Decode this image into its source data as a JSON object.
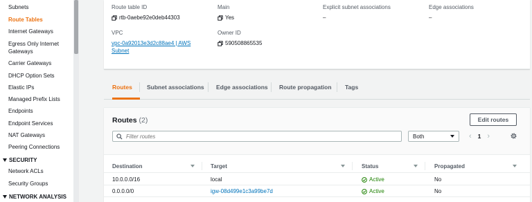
{
  "sidebar": {
    "items": [
      {
        "label": "Subnets",
        "active": false
      },
      {
        "label": "Route Tables",
        "active": true
      },
      {
        "label": "Internet Gateways",
        "active": false
      },
      {
        "label": "Egress Only Internet",
        "active": false
      },
      {
        "label": "Gateways",
        "active": false
      },
      {
        "label": "Carrier Gateways",
        "active": false
      },
      {
        "label": "DHCP Option Sets",
        "active": false
      },
      {
        "label": "Elastic IPs",
        "active": false
      },
      {
        "label": "Managed Prefix Lists",
        "active": false
      },
      {
        "label": "Endpoints",
        "active": false
      },
      {
        "label": "Endpoint Services",
        "active": false
      },
      {
        "label": "NAT Gateways",
        "active": false
      },
      {
        "label": "Peering Connections",
        "active": false
      }
    ],
    "security_section": "SECURITY",
    "security_items": [
      "Network ACLs",
      "Security Groups"
    ],
    "network_analysis_section": "NETWORK ANALYSIS"
  },
  "details": {
    "route_table_id_label": "Route table ID",
    "route_table_id": "rtb-0aebe92e0deb44303",
    "main_label": "Main",
    "main_value": "Yes",
    "explicit_label": "Explicit subnet associations",
    "explicit_value": "–",
    "edge_label": "Edge associations",
    "edge_value": "–",
    "vpc_label": "VPC",
    "vpc_line1": "vpc-0a92013e3d2c88ae4 | AWS",
    "vpc_line2": "Subnet",
    "owner_label": "Owner ID",
    "owner_value": "590508865535"
  },
  "tabs": [
    "Routes",
    "Subnet associations",
    "Edge associations",
    "Route propagation",
    "Tags"
  ],
  "routes": {
    "title": "Routes",
    "count": "(2)",
    "edit_button": "Edit routes",
    "filter_placeholder": "Filter routes",
    "select_value": "Both",
    "page": "1",
    "columns": [
      "Destination",
      "Target",
      "Status",
      "Propagated"
    ],
    "rows": [
      {
        "destination": "10.0.0.0/16",
        "target": "local",
        "status": "Active",
        "propagated": "No"
      },
      {
        "destination": "0.0.0.0/0",
        "target": "igw-08d499e1c3a99be7d",
        "status": "Active",
        "propagated": "No"
      }
    ]
  },
  "colors": {
    "accent": "#ec7211",
    "link": "#0073bb",
    "success": "#1d8102"
  },
  "icons": [
    "copy-icon",
    "search-icon",
    "chevron-left-icon",
    "chevron-right-icon",
    "gear-icon",
    "check-circle-icon",
    "sort-icon",
    "caret-down-icon"
  ]
}
